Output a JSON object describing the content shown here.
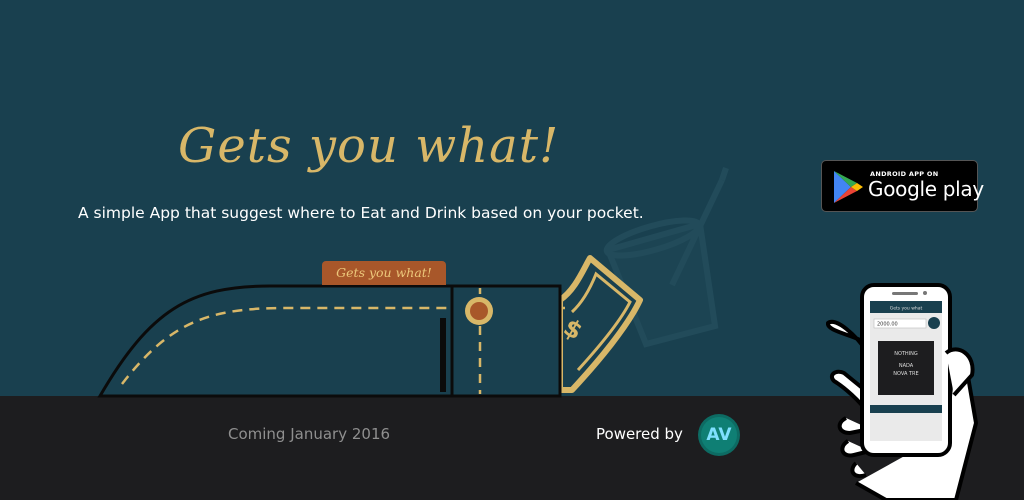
{
  "headline": "Gets you what!",
  "tagline": "A simple App that suggest where to Eat and Drink based on your pocket.",
  "tab_label": "Gets you what!",
  "play_badge": {
    "small_text": "ANDROID APP ON",
    "big_text": "Google play"
  },
  "footer": {
    "coming_text": "Coming January 2016",
    "powered_text": "Powered by",
    "logo_text": "AV"
  },
  "phone_screen": {
    "title": "Gets you what",
    "amount": "2000.00",
    "card_line1": "NOTHING",
    "card_line2": "NADA",
    "card_line3": "NOVA TRE"
  },
  "colors": {
    "background_top": "#19404f",
    "background_bottom": "#1d1d1f",
    "accent_gold": "#d8b768",
    "tab_brown": "#a8572a"
  }
}
